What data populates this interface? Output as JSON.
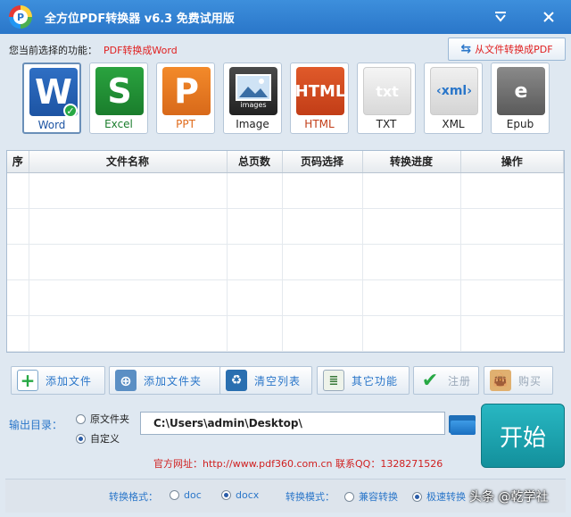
{
  "window": {
    "title": "全方位PDF转换器 v6.3 免费试用版",
    "logo_letter": "P",
    "menu_icon": "chevron-down-icon",
    "close_icon": "close-icon"
  },
  "function": {
    "label": "您当前选择的功能：",
    "value": "PDF转换成Word"
  },
  "switch_mode": {
    "label": "从文件转换成PDF",
    "icon": "swap-arrows-icon"
  },
  "formats": [
    {
      "id": "word",
      "label": "Word",
      "glyph": "W",
      "selected": true
    },
    {
      "id": "excel",
      "label": "Excel",
      "glyph": "S"
    },
    {
      "id": "ppt",
      "label": "PPT",
      "glyph": "P"
    },
    {
      "id": "image",
      "label": "Image",
      "glyph": "images"
    },
    {
      "id": "html",
      "label": "HTML",
      "glyph": "HTML"
    },
    {
      "id": "txt",
      "label": "TXT",
      "glyph": "txt"
    },
    {
      "id": "xml",
      "label": "XML",
      "glyph": "‹xml›"
    },
    {
      "id": "epub",
      "label": "Epub",
      "glyph": "e"
    }
  ],
  "table": {
    "columns": [
      "序",
      "文件名称",
      "总页数",
      "页码选择",
      "转换进度",
      "操作"
    ]
  },
  "actions": {
    "add_file": "添加文件",
    "add_folder": "添加文件夹",
    "clear_list": "清空列表",
    "other": "其它功能",
    "register": "注册",
    "buy": "购买"
  },
  "output": {
    "label": "输出目录：",
    "option_source": "原文件夹",
    "option_custom": "自定义",
    "selected": "custom",
    "path": "C:\\Users\\admin\\Desktop\\",
    "start": "开始"
  },
  "info": {
    "site": "官方网址：http://www.pdf360.com.cn",
    "qq": "联系QQ：1328271526"
  },
  "bottom": {
    "format_label": "转换格式：",
    "fmt_doc": "doc",
    "fmt_docx": "docx",
    "fmt_selected": "docx",
    "mode_label": "转换模式：",
    "mode_compat": "兼容转换",
    "mode_fast": "极速转换",
    "mode_selected": "fast"
  },
  "watermark": "头条 @乾学社"
}
